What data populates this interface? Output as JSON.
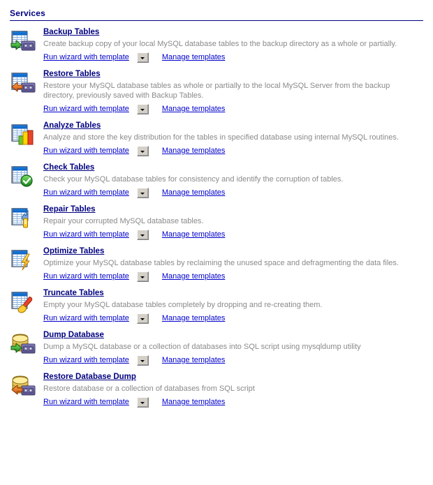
{
  "header": {
    "title": "Services"
  },
  "labels": {
    "run_wizard": "Run wizard with template",
    "manage_templates": "Manage templates",
    "dropdown_icon": "chevron-down-icon"
  },
  "colors": {
    "title_navy": "#000080",
    "link_blue": "#0000cc",
    "description_gray": "#8a8a8a",
    "button_face": "#d4d0c8",
    "background": "#ffffff"
  },
  "services": [
    {
      "title": "Backup Tables",
      "description": "Create backup copy of your local MySQL database tables to the backup directory as a whole or partially.",
      "icon": "table-backup-to-tape-icon",
      "run_label": "Run wizard with template",
      "manage_label": "Manage templates"
    },
    {
      "title": "Restore Tables",
      "description": "Restore your MySQL database tables as whole or partially to the local MySQL Server from the backup directory, previously saved with Backup Tables.",
      "icon": "table-restore-from-tape-icon",
      "run_label": "Run wizard with template",
      "manage_label": "Manage templates"
    },
    {
      "title": "Analyze Tables",
      "description": "Analyze and store the key distribution for the tables in specified database using internal MySQL routines.",
      "icon": "table-bar-chart-icon",
      "run_label": "Run wizard with template",
      "manage_label": "Manage templates"
    },
    {
      "title": "Check Tables",
      "description": "Check your MySQL database tables for consistency and identify the corruption of tables.",
      "icon": "table-check-icon",
      "run_label": "Run wizard with template",
      "manage_label": "Manage templates"
    },
    {
      "title": "Repair Tables",
      "description": "Repair your corrupted MySQL database tables.",
      "icon": "table-wrench-icon",
      "run_label": "Run wizard with template",
      "manage_label": "Manage templates"
    },
    {
      "title": "Optimize Tables",
      "description": "Optimize your MySQL database tables by reclaiming the unused space and defragmenting the data files.",
      "icon": "table-lightning-icon",
      "run_label": "Run wizard with template",
      "manage_label": "Manage templates"
    },
    {
      "title": "Truncate Tables",
      "description": "Empty your MySQL database tables completely by dropping and re-creating them.",
      "icon": "table-broom-icon",
      "run_label": "Run wizard with template",
      "manage_label": "Manage templates"
    },
    {
      "title": "Dump Database",
      "description": "Dump a MySQL database or a collection of databases into SQL script using mysqldump utility",
      "icon": "database-dump-to-tape-icon",
      "run_label": "Run wizard with template",
      "manage_label": "Manage templates"
    },
    {
      "title": "Restore Database Dump",
      "description": "Restore database or a collection of databases from SQL script",
      "icon": "database-restore-from-tape-icon",
      "run_label": "Run wizard with template",
      "manage_label": "Manage templates"
    }
  ]
}
